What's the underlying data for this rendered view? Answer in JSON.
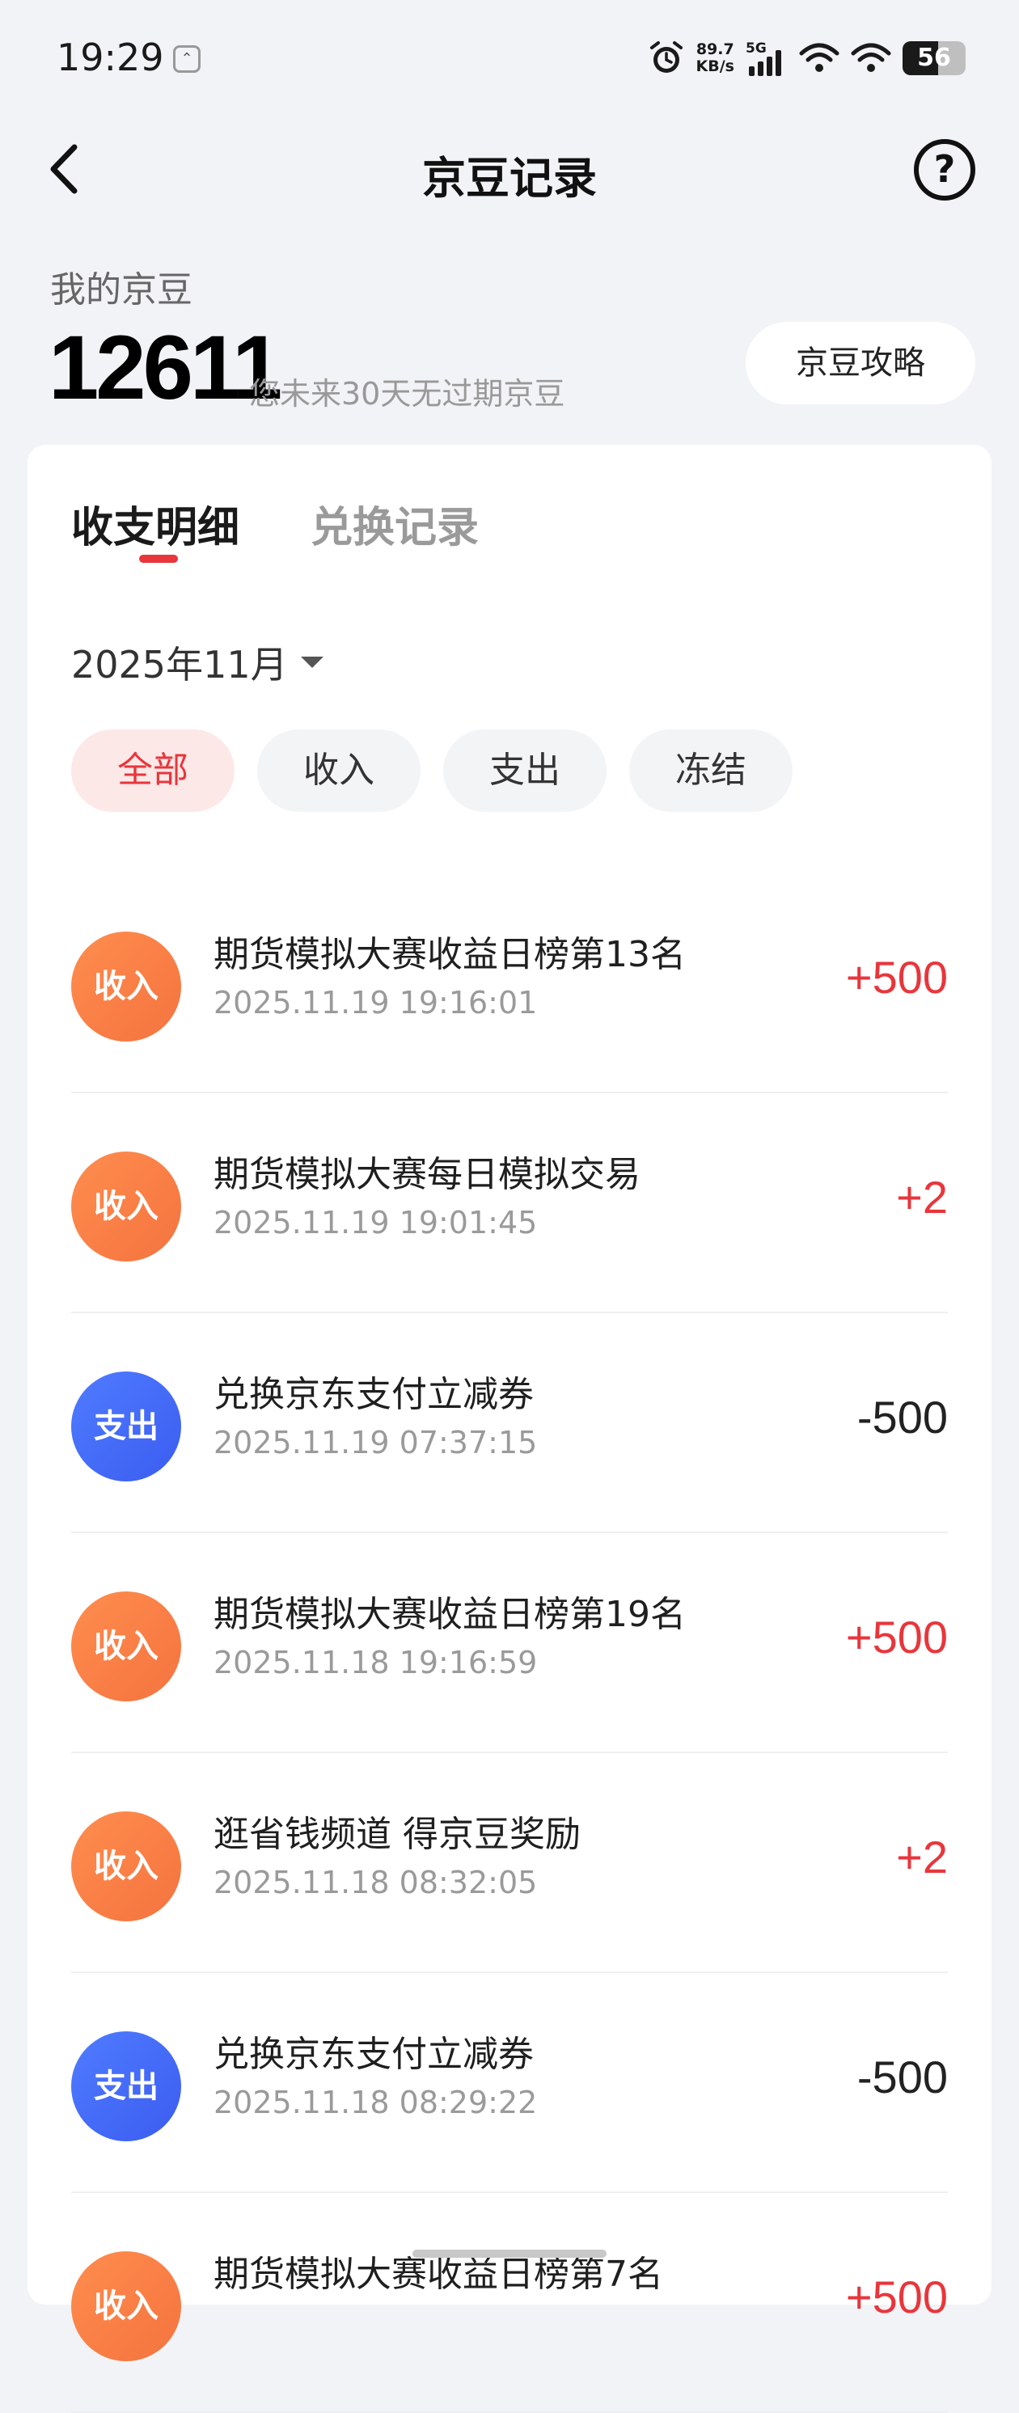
{
  "status_bar": {
    "time": "19:29",
    "net_speed_value": "89.7",
    "net_speed_unit": "KB/s",
    "network_type": "5G",
    "battery_level": "56",
    "battery_fraction": 0.56
  },
  "nav": {
    "title": "京豆记录",
    "help_label": "?"
  },
  "summary": {
    "label": "我的京豆",
    "count": "12611",
    "expire_note": "您未来30天无过期京豆",
    "guide_button": "京豆攻略"
  },
  "tabs": {
    "active": "收支明细",
    "inactive": "兑换记录"
  },
  "month": "2025年11月",
  "filters": [
    "全部",
    "收入",
    "支出",
    "冻结"
  ],
  "records": [
    {
      "type": "收入",
      "title": "期货模拟大赛收益日榜第13名",
      "time": "2025.11.19 19:16:01",
      "amount": "+500"
    },
    {
      "type": "收入",
      "title": "期货模拟大赛每日模拟交易",
      "time": "2025.11.19 19:01:45",
      "amount": "+2"
    },
    {
      "type": "支出",
      "title": "兑换京东支付立减券",
      "time": "2025.11.19 07:37:15",
      "amount": "-500"
    },
    {
      "type": "收入",
      "title": "期货模拟大赛收益日榜第19名",
      "time": "2025.11.18 19:16:59",
      "amount": "+500"
    },
    {
      "type": "收入",
      "title": "逛省钱频道 得京豆奖励",
      "time": "2025.11.18 08:32:05",
      "amount": "+2"
    },
    {
      "type": "支出",
      "title": "兑换京东支付立减券",
      "time": "2025.11.18 08:29:22",
      "amount": "-500"
    },
    {
      "type": "收入",
      "title": "期货模拟大赛收益日榜第7名",
      "time": "",
      "amount": "+500"
    }
  ],
  "colors": {
    "accent": "#e8363b",
    "income_badge": "#f67b44",
    "expense_badge": "#4468f5",
    "background": "#f2f3f7"
  }
}
